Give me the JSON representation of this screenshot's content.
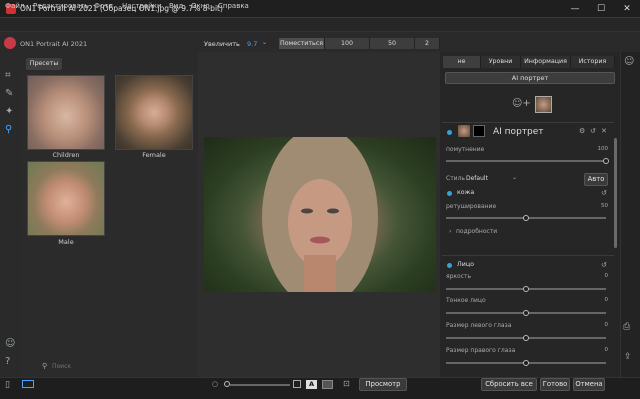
{
  "window": {
    "title": "ON1 Portrait AI 2021 (Образец ON1.jpg @ 9.7% 8-bit)",
    "minimize_glyph": "—",
    "maximize_glyph": "☐",
    "close_glyph": "✕"
  },
  "menu": [
    "Файл",
    "Редактировать",
    "Фото",
    "Настройки",
    "Вид",
    "Окно",
    "Справка"
  ],
  "app_name": "ON1 Portrait AI 2021",
  "toolbar": {
    "zoom_label": "Увеличить",
    "zoom_value": "9.7",
    "fit": "Поместиться",
    "z100": "100",
    "z50": "50",
    "z2": "2"
  },
  "presets": {
    "tab": "Пресеты",
    "items": [
      {
        "label": "Children"
      },
      {
        "label": "Female"
      },
      {
        "label": "Male"
      }
    ],
    "search_placeholder": "Поиск"
  },
  "right": {
    "tabs": [
      "не",
      "Уровни",
      "Информация",
      "История"
    ],
    "ai_button": "AI портрет",
    "module_title": "AI портрет",
    "blur_label": "помутнение",
    "blur_value": "100",
    "blur_level": 1.0,
    "style_label": "Стиль",
    "style_value": "Default",
    "auto_btn": "Авто",
    "skin_title": "кожа",
    "retouch_label": "ретуширование",
    "retouch_value": "50",
    "retouch_level": 0.5,
    "details": "подробности",
    "face_title": "Лицо",
    "brightness_label": "яркость",
    "brightness_value": "0",
    "brightness_level": 0.5,
    "thin_label": "Тонкое лицо",
    "thin_value": "0",
    "thin_level": 0.5,
    "left_eye_label": "Размер левого глаза",
    "left_eye_value": "0",
    "left_eye_level": 0.5,
    "right_eye_label": "Размер правого глаза",
    "right_eye_value": "0",
    "right_eye_level": 0.5
  },
  "bottom": {
    "preview": "Просмотр",
    "reset_all": "Сбросить все",
    "done": "Готово",
    "cancel": "Отмена"
  },
  "colors": {
    "accent": "#3aa0d9",
    "zoom_value": "#4ba3ff",
    "logo": "#c93a46"
  }
}
